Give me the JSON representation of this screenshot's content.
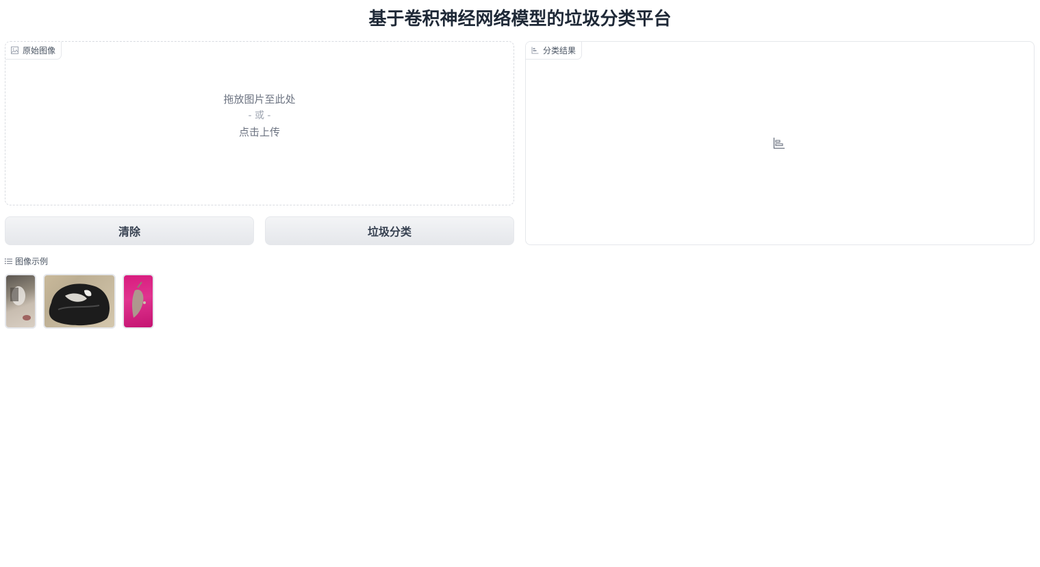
{
  "header": {
    "title": "基于卷积神经网络模型的垃圾分类平台"
  },
  "input_panel": {
    "label": "原始图像",
    "label_icon": "image-icon",
    "drop_text": "拖放图片至此处",
    "or_text": "- 或 -",
    "click_text": "点击上传"
  },
  "output_panel": {
    "label": "分类结果",
    "label_icon": "bar-chart-icon",
    "empty_icon": "bar-chart-icon"
  },
  "buttons": {
    "clear_label": "清除",
    "classify_label": "垃圾分类"
  },
  "examples": {
    "label": "图像示例",
    "label_icon": "list-icon",
    "items": [
      "example-1",
      "example-2",
      "example-3"
    ]
  },
  "colors": {
    "title": "#1f2937",
    "button_bg": "#e5e7eb",
    "border": "#e5e7eb",
    "example_3_bg": "#d81b7e"
  }
}
